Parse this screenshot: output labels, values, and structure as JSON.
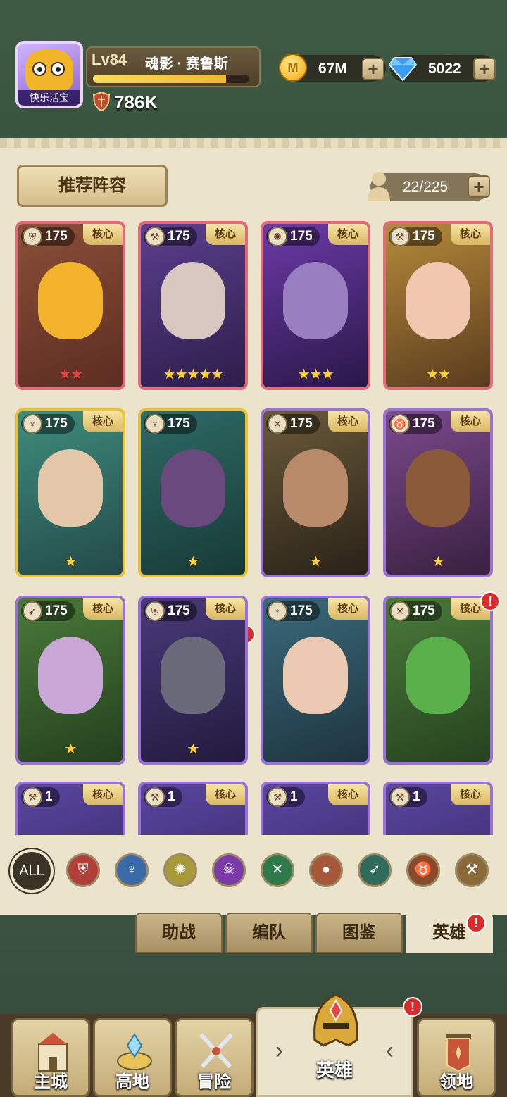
{
  "player": {
    "avatar_tag": "快乐活宝",
    "level": "Lv84",
    "name": "魂影 · 赛鲁斯",
    "xp_fraction": 0.85,
    "power": "786K"
  },
  "resources": {
    "gold": "67M",
    "gold_icon_letter": "M",
    "gems": "5022"
  },
  "toolbar": {
    "recommend_label": "推荐阵容",
    "hero_count": "22/225"
  },
  "cards": [
    {
      "level": "175",
      "core": "核心",
      "stars": "★★",
      "star_color": "red"
    },
    {
      "level": "175",
      "core": "核心",
      "stars": "★★★★★",
      "star_color": "gold"
    },
    {
      "level": "175",
      "core": "核心",
      "stars": "★★★",
      "star_color": "gold"
    },
    {
      "level": "175",
      "core": "核心",
      "stars": "★★",
      "star_color": "gold"
    },
    {
      "level": "175",
      "core": "核心",
      "stars": "★",
      "star_color": "gold"
    },
    {
      "level": "175",
      "core": "",
      "stars": "★",
      "star_color": "gold",
      "alert": "!"
    },
    {
      "level": "175",
      "core": "核心",
      "stars": "★",
      "star_color": "gold"
    },
    {
      "level": "175",
      "core": "核心",
      "stars": "★",
      "star_color": "gold"
    },
    {
      "level": "175",
      "core": "核心",
      "stars": "★",
      "star_color": "gold"
    },
    {
      "level": "175",
      "core": "核心",
      "stars": "★",
      "star_color": "gold"
    },
    {
      "level": "175",
      "core": "核心",
      "stars": "",
      "star_color": "gold"
    },
    {
      "level": "175",
      "core": "核心",
      "stars": "",
      "star_color": "gold",
      "alert": "!"
    },
    {
      "level": "1",
      "core": "核心"
    },
    {
      "level": "1",
      "core": "核心"
    },
    {
      "level": "1",
      "core": "核心"
    },
    {
      "level": "1",
      "core": "核心"
    }
  ],
  "filters": {
    "all": "ALL",
    "icons": [
      "shield-filter-icon",
      "staff-filter-icon",
      "wings-filter-icon",
      "skull-filter-icon",
      "daggers-filter-icon",
      "paw-filter-icon",
      "bow-filter-icon",
      "bull-filter-icon",
      "hammer-filter-icon"
    ]
  },
  "subtabs": {
    "support": "助战",
    "formation": "编队",
    "codex": "图鉴",
    "heroes": "英雄",
    "heroes_alert": "!"
  },
  "nav": {
    "main_city": "主城",
    "highland": "高地",
    "adventure": "冒险",
    "heroes": "英雄",
    "territory": "领地",
    "heroes_alert": "!"
  }
}
